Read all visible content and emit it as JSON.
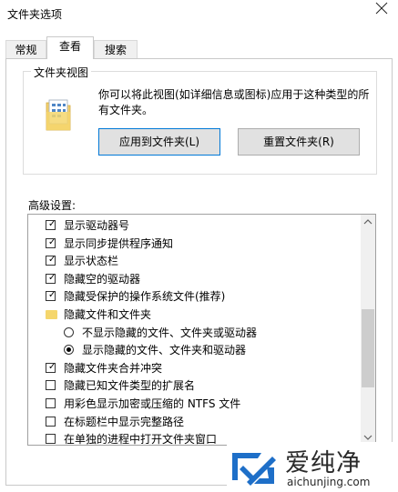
{
  "window": {
    "title": "文件夹选项"
  },
  "tabs": [
    {
      "label": "常规"
    },
    {
      "label": "查看"
    },
    {
      "label": "搜索"
    }
  ],
  "folder_views": {
    "legend": "文件夹视图",
    "description": "你可以将此视图(如详细信息或图标)应用于这种类型的所有文件夹。",
    "apply_button": "应用到文件夹(L)",
    "reset_button": "重置文件夹(R)"
  },
  "advanced": {
    "label": "高级设置:",
    "items": [
      {
        "type": "checkbox",
        "checked": true,
        "indent": 0,
        "label": "显示驱动器号"
      },
      {
        "type": "checkbox",
        "checked": true,
        "indent": 0,
        "label": "显示同步提供程序通知"
      },
      {
        "type": "checkbox",
        "checked": true,
        "indent": 0,
        "label": "显示状态栏"
      },
      {
        "type": "checkbox",
        "checked": true,
        "indent": 0,
        "label": "隐藏空的驱动器"
      },
      {
        "type": "checkbox",
        "checked": true,
        "indent": 0,
        "label": "隐藏受保护的操作系统文件(推荐)"
      },
      {
        "type": "folder",
        "checked": false,
        "indent": 0,
        "label": "隐藏文件和文件夹"
      },
      {
        "type": "radio",
        "checked": false,
        "indent": 1,
        "label": "不显示隐藏的文件、文件夹或驱动器"
      },
      {
        "type": "radio",
        "checked": true,
        "indent": 1,
        "label": "显示隐藏的文件、文件夹和驱动器"
      },
      {
        "type": "checkbox",
        "checked": true,
        "indent": 0,
        "label": "隐藏文件夹合并冲突"
      },
      {
        "type": "checkbox",
        "checked": false,
        "indent": 0,
        "label": "隐藏已知文件类型的扩展名"
      },
      {
        "type": "checkbox",
        "checked": false,
        "indent": 0,
        "label": "用彩色显示加密或压缩的 NTFS 文件"
      },
      {
        "type": "checkbox",
        "checked": false,
        "indent": 0,
        "label": "在标题栏中显示完整路径"
      },
      {
        "type": "checkbox",
        "checked": false,
        "indent": 0,
        "label": "在单独的进程中打开文件夹窗口"
      }
    ],
    "scroll_position": 0.42
  },
  "watermark": {
    "title": "爱纯净",
    "url": "aichunjing.com"
  },
  "colors": {
    "accent": "#0078d7",
    "folder": "#f5d66c",
    "logo": "#1e6fc8"
  }
}
